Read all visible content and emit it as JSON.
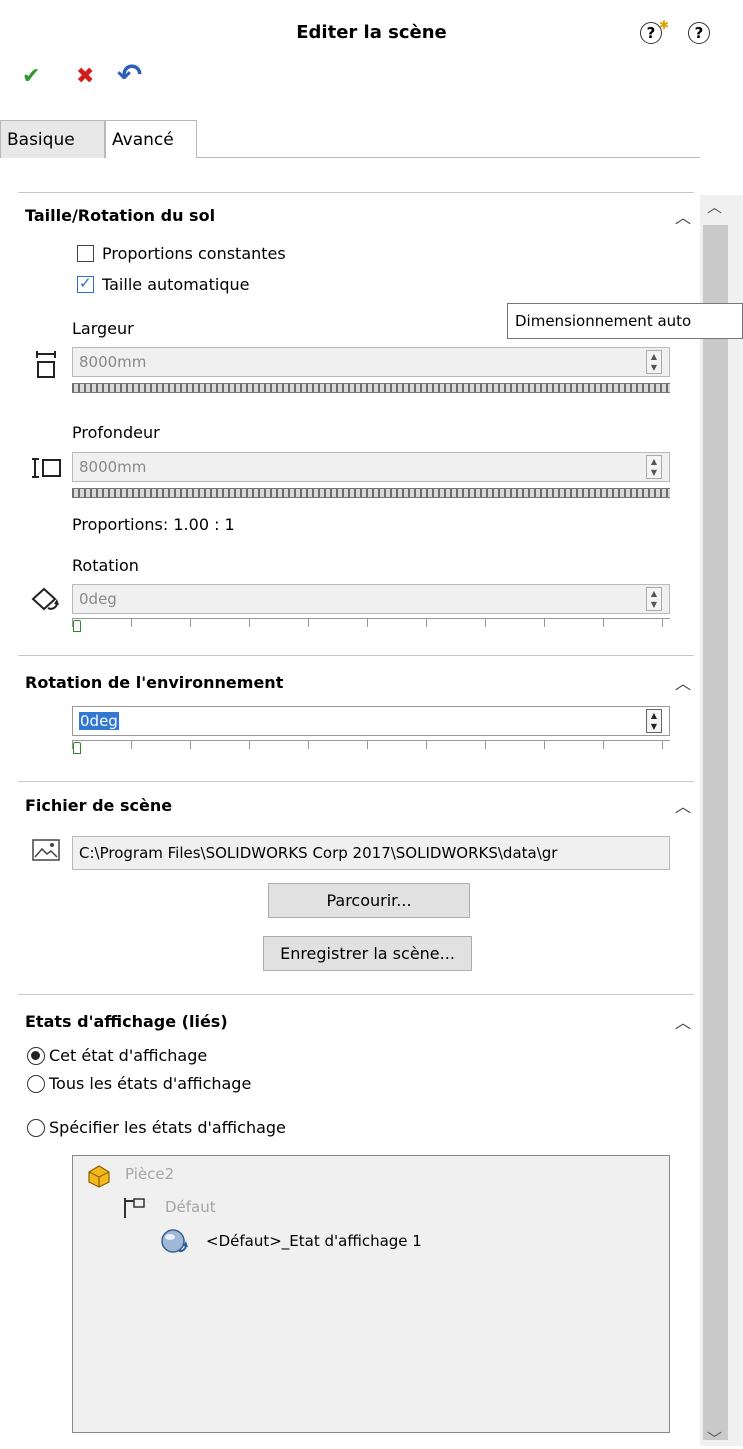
{
  "header": {
    "title": "Editer la scène",
    "toolbar": {
      "ok": "✔",
      "cancel": "✖",
      "undo": "↶"
    },
    "whats_new_icon": "?",
    "help_icon": "?"
  },
  "tabs": [
    {
      "label": "Basique"
    },
    {
      "label": "Avancé"
    }
  ],
  "floor": {
    "title": "Taille/Rotation du sol",
    "keep_proportions": "Proportions constantes",
    "auto_size": "Taille automatique",
    "width_label": "Largeur",
    "width_value": "8000mm",
    "depth_label": "Profondeur",
    "depth_value": "8000mm",
    "proportions": "Proportions: 1.00 : 1",
    "rotation_label": "Rotation",
    "rotation_value": "0deg",
    "tooltip": "Dimensionnement auto"
  },
  "env": {
    "title": "Rotation de l'environnement",
    "value": "0deg"
  },
  "scene_file": {
    "title": "Fichier de scène",
    "path": "C:\\Program Files\\SOLIDWORKS Corp 2017\\SOLIDWORKS\\data\\gr",
    "browse": "Parcourir...",
    "save": "Enregistrer la scène..."
  },
  "display": {
    "title": "Etats d'affichage (liés)",
    "opt_this": "Cet état d'affichage",
    "opt_all": "Tous les états d'affichage",
    "opt_specify": "Spécifier les états d'affichage",
    "tree_part": "Pièce2",
    "tree_config": "Défaut",
    "tree_state": "<Défaut>_Etat d'affichage 1"
  }
}
